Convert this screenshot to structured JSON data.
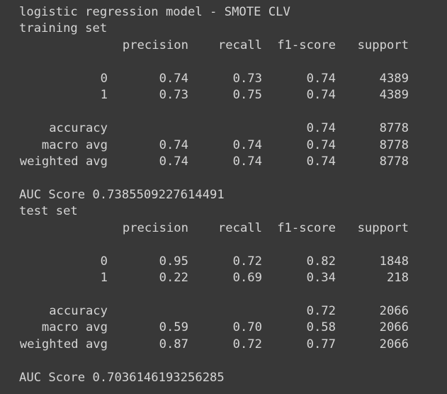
{
  "output": {
    "title": "logistic regression model - SMOTE CLV",
    "training": {
      "set_label": "training set",
      "headers": [
        "precision",
        "recall",
        "f1-score",
        "support"
      ],
      "class_rows": [
        {
          "label": "0",
          "precision": "0.74",
          "recall": "0.73",
          "f1": "0.74",
          "support": "4389"
        },
        {
          "label": "1",
          "precision": "0.73",
          "recall": "0.75",
          "f1": "0.74",
          "support": "4389"
        }
      ],
      "summary_rows": [
        {
          "label": "accuracy",
          "precision": "",
          "recall": "",
          "f1": "0.74",
          "support": "8778"
        },
        {
          "label": "macro avg",
          "precision": "0.74",
          "recall": "0.74",
          "f1": "0.74",
          "support": "8778"
        },
        {
          "label": "weighted avg",
          "precision": "0.74",
          "recall": "0.74",
          "f1": "0.74",
          "support": "8778"
        }
      ],
      "auc": "AUC Score 0.7385509227614491"
    },
    "test": {
      "set_label": "test set",
      "headers": [
        "precision",
        "recall",
        "f1-score",
        "support"
      ],
      "class_rows": [
        {
          "label": "0",
          "precision": "0.95",
          "recall": "0.72",
          "f1": "0.82",
          "support": "1848"
        },
        {
          "label": "1",
          "precision": "0.22",
          "recall": "0.69",
          "f1": "0.34",
          "support": "218"
        }
      ],
      "summary_rows": [
        {
          "label": "accuracy",
          "precision": "",
          "recall": "",
          "f1": "0.72",
          "support": "2066"
        },
        {
          "label": "macro avg",
          "precision": "0.59",
          "recall": "0.70",
          "f1": "0.58",
          "support": "2066"
        },
        {
          "label": "weighted avg",
          "precision": "0.87",
          "recall": "0.72",
          "f1": "0.77",
          "support": "2066"
        }
      ],
      "auc": "AUC Score 0.7036146193256285"
    }
  },
  "colors": {
    "background": "#383838",
    "text": "#d5d5d5"
  }
}
